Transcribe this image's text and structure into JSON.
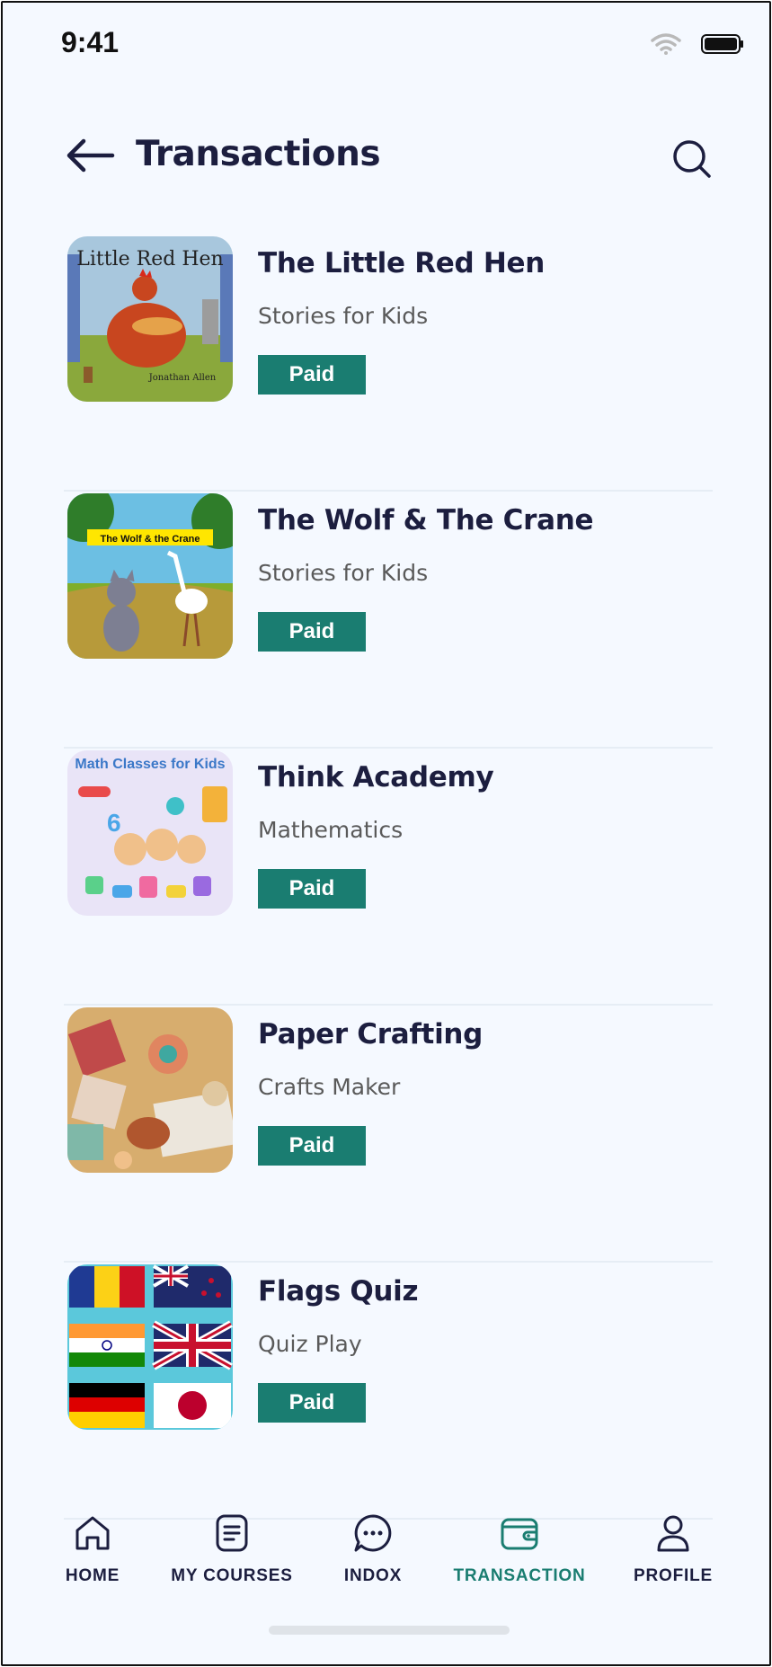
{
  "status_bar": {
    "time": "9:41"
  },
  "header": {
    "title": "Transactions"
  },
  "transactions": [
    {
      "title": "The Little Red Hen",
      "subtitle": "Stories for Kids",
      "status": "Paid",
      "thumb_text": "Little Red Hen",
      "thumb_sub": "Jonathan Allen"
    },
    {
      "title": "The Wolf & The Crane",
      "subtitle": "Stories for Kids",
      "status": "Paid",
      "thumb_text": "The Wolf & the Crane"
    },
    {
      "title": "Think Academy",
      "subtitle": "Mathematics",
      "status": "Paid",
      "thumb_text": "Math Classes for Kids"
    },
    {
      "title": "Paper Crafting",
      "subtitle": "Crafts Maker",
      "status": "Paid"
    },
    {
      "title": "Flags Quiz",
      "subtitle": "Quiz Play",
      "status": "Paid"
    }
  ],
  "bottom_nav": [
    {
      "label": "HOME",
      "icon": "home-icon",
      "active": false
    },
    {
      "label": "MY COURSES",
      "icon": "courses-icon",
      "active": false
    },
    {
      "label": "INDOX",
      "icon": "chat-icon",
      "active": false
    },
    {
      "label": "TRANSACTION",
      "icon": "wallet-icon",
      "active": true
    },
    {
      "label": "PROFILE",
      "icon": "profile-icon",
      "active": false
    }
  ],
  "colors": {
    "accent": "#1a7d71",
    "text_dark": "#1c1e3f",
    "background": "#f5f9ff"
  }
}
